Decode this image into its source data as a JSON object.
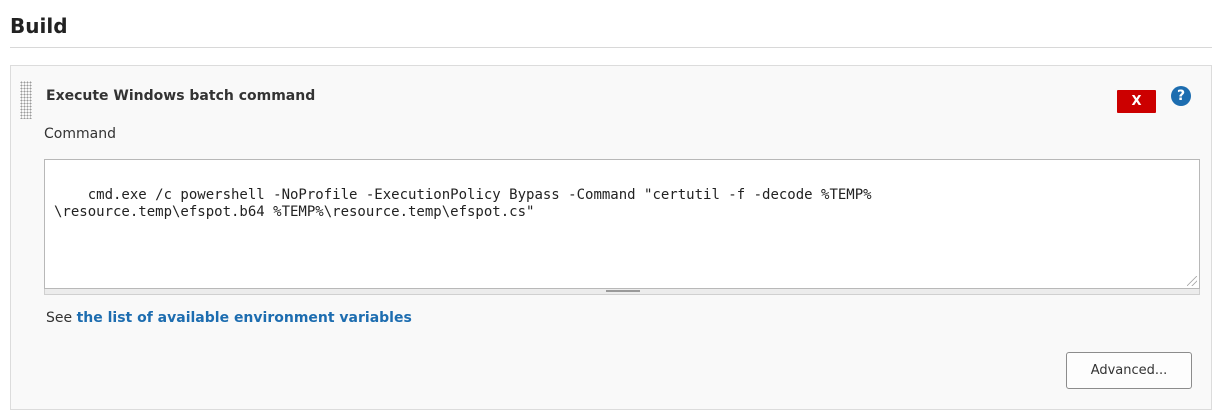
{
  "section": {
    "title": "Build"
  },
  "step": {
    "title": "Execute Windows batch command",
    "delete_label": "X",
    "help_label": "?",
    "field_label": "Command",
    "command_value": "cmd.exe /c powershell -NoProfile -ExecutionPolicy Bypass -Command \"certutil -f -decode %TEMP%\n\\resource.temp\\efspot.b64 %TEMP%\\resource.temp\\efspot.cs\"",
    "help_prefix": "See ",
    "help_link": "the list of available environment variables",
    "advanced_label": "Advanced..."
  },
  "colors": {
    "accent": "#1d6db0",
    "danger": "#cc0000",
    "panel_bg": "#f9f9f9"
  },
  "icons": {
    "drag": "drag-handle-icon",
    "help": "help-icon",
    "resize": "resize-icon"
  }
}
